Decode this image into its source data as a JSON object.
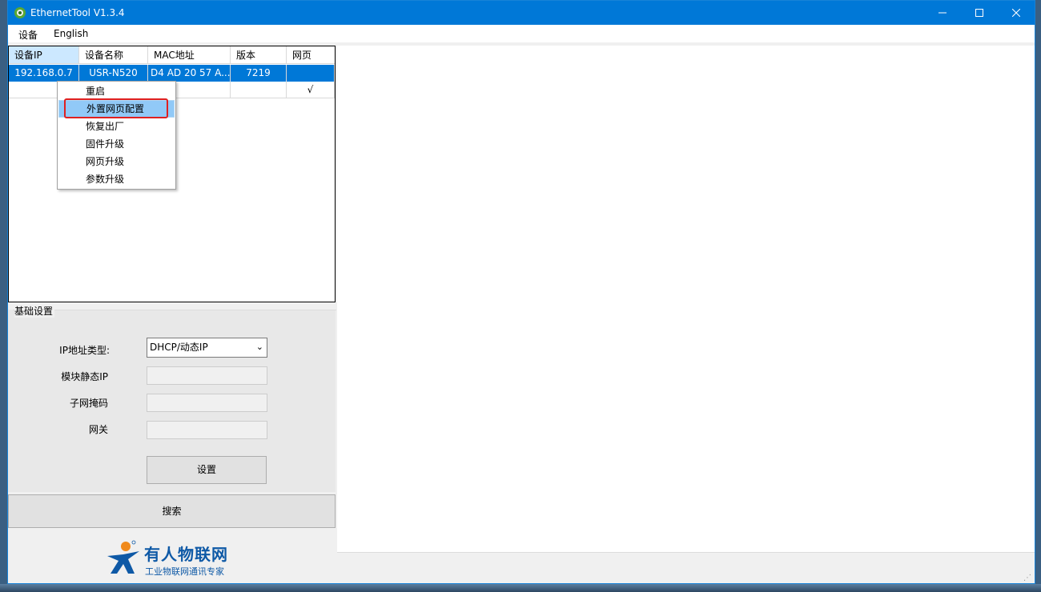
{
  "window": {
    "title": "EthernetTool V1.3.4"
  },
  "menubar": {
    "items": [
      "设备",
      "English"
    ]
  },
  "device_list": {
    "columns": [
      "设备IP",
      "设备名称",
      "MAC地址",
      "版本",
      "网页"
    ],
    "rows": [
      {
        "ip": "192.168.0.7",
        "name": "USR-N520",
        "mac": "D4 AD 20 57 A...",
        "version": "7219",
        "web": ""
      },
      {
        "ip": "",
        "name": "",
        "mac": "",
        "version": "",
        "web": "√"
      }
    ]
  },
  "context_menu": {
    "items": [
      "重启",
      "外置网页配置",
      "恢复出厂",
      "固件升级",
      "网页升级",
      "参数升级"
    ],
    "highlighted": "外置网页配置"
  },
  "basic_settings": {
    "group_title": "基础设置",
    "ip_type_label": "IP地址类型:",
    "ip_type_value": "DHCP/动态IP",
    "static_ip_label": "模块静态IP",
    "static_ip_value": "",
    "subnet_label": "子网掩码",
    "subnet_value": "",
    "gateway_label": "网关",
    "gateway_value": "",
    "set_button": "设置"
  },
  "search_button": "搜索",
  "logo": {
    "main": "有人物联网",
    "sub": "工业物联网通讯专家"
  },
  "colors": {
    "titlebar": "#0078d7",
    "selection": "#0078d7",
    "highlight_box": "#e02020",
    "logo": "#0e59a6"
  }
}
